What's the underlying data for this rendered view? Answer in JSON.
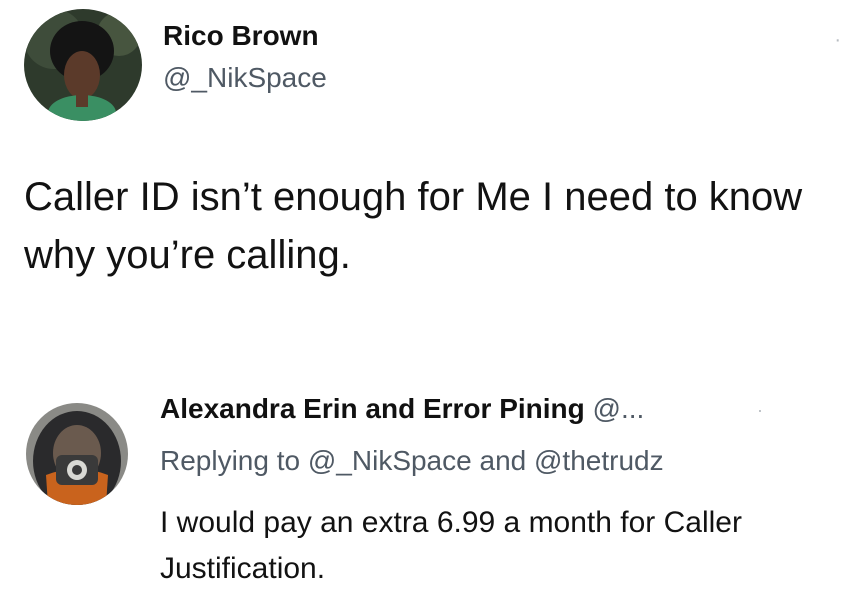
{
  "tweet": {
    "author_name": "Rico Brown",
    "author_handle": "@_NikSpace",
    "avatar_icon": "profile-photo-icon",
    "text": "Caller ID isn’t enough for Me I need to know why you’re calling."
  },
  "reply": {
    "author_name": "Alexandra Erin and Error Pining",
    "author_handle_truncated": "@...",
    "avatar_icon": "masked-figure-avatar-icon",
    "replying_prefix": "Replying to",
    "mention_1": "@_NikSpace",
    "conjunction": "and",
    "mention_2": "@thetrudz",
    "text": "I would pay an extra 6.99 a month for Caller Justification."
  },
  "colors": {
    "text_primary": "#121212",
    "text_secondary": "#4f5964",
    "background": "#ffffff"
  }
}
